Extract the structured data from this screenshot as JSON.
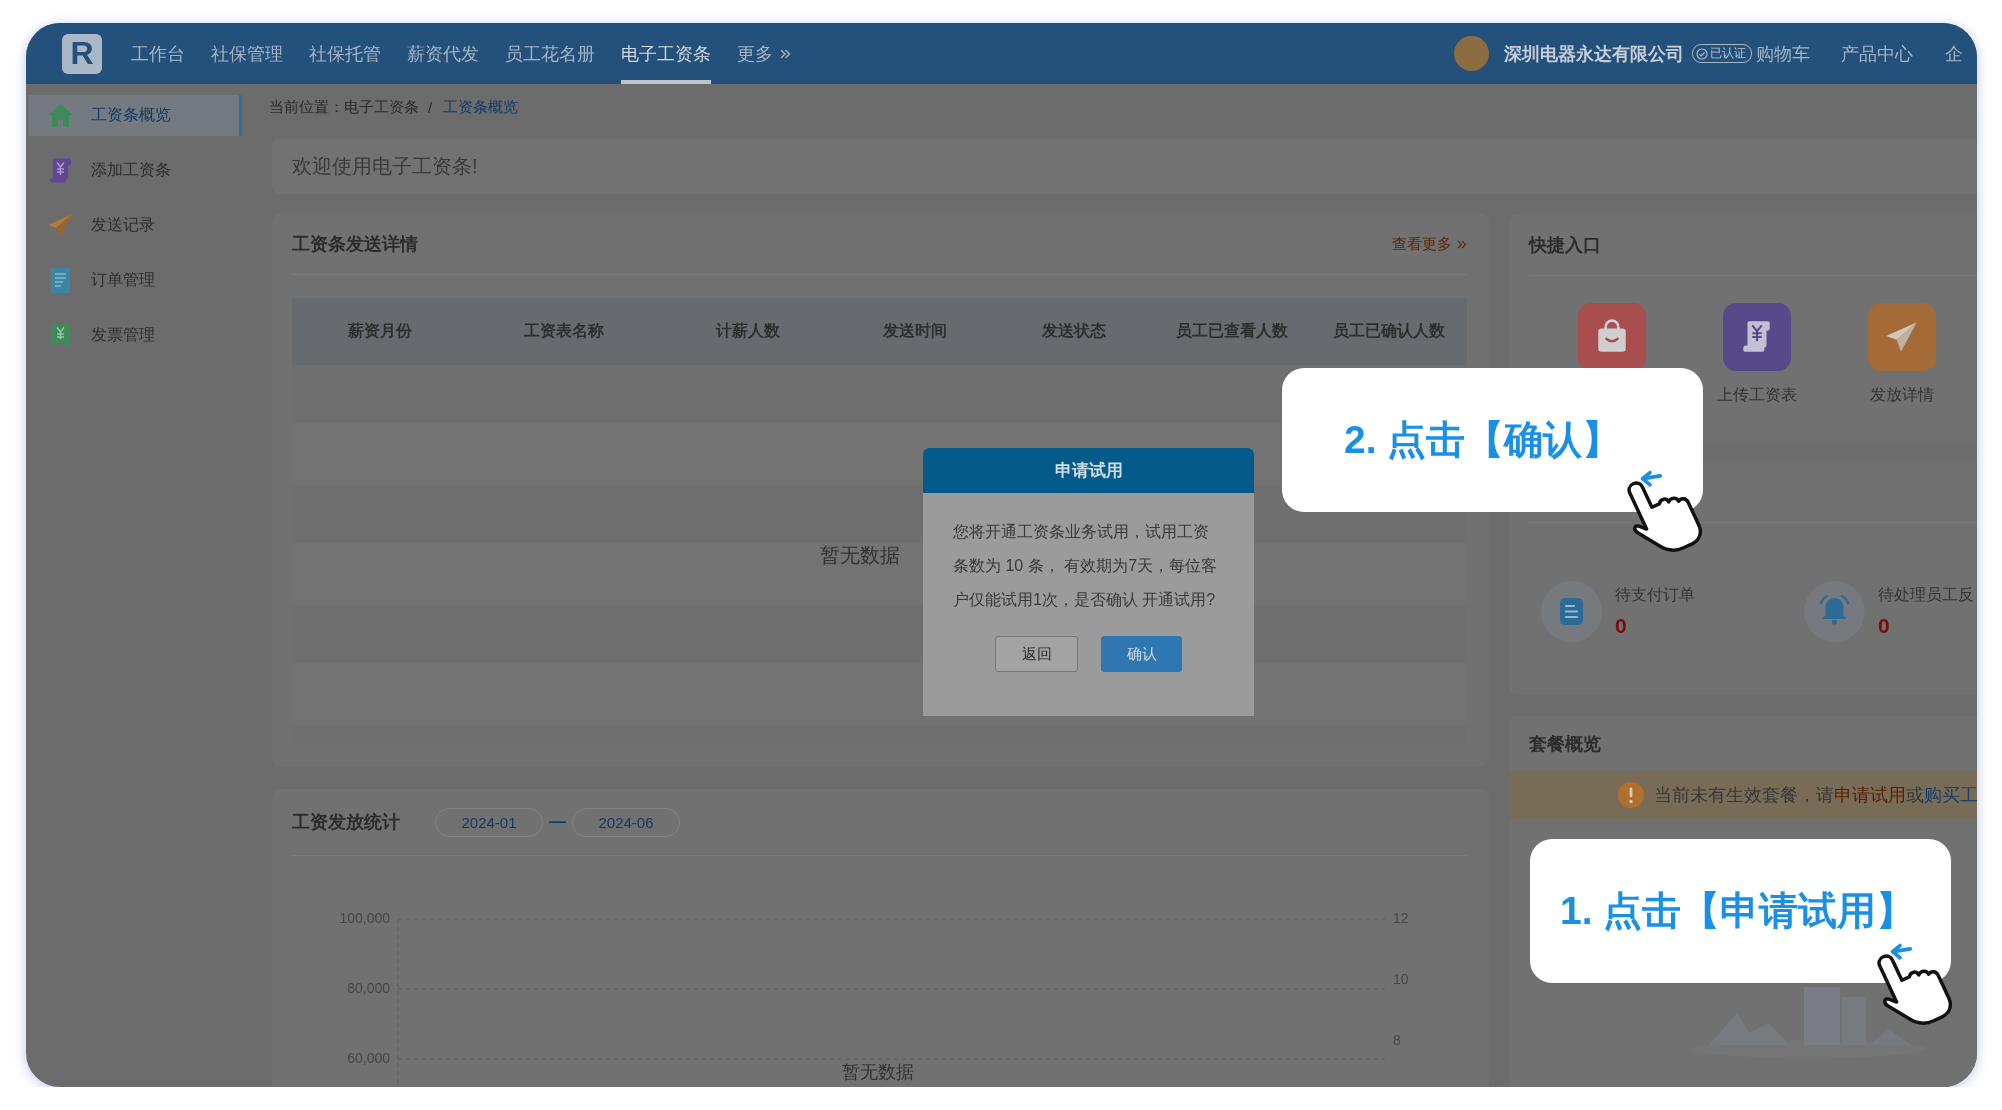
{
  "nav": {
    "logo": "R",
    "items": [
      {
        "label": "工作台",
        "selected": false,
        "more": false
      },
      {
        "label": "社保管理",
        "selected": false,
        "more": false
      },
      {
        "label": "社保托管",
        "selected": false,
        "more": false
      },
      {
        "label": "薪资代发",
        "selected": false,
        "more": false
      },
      {
        "label": "员工花名册",
        "selected": false,
        "more": false
      },
      {
        "label": "电子工资条",
        "selected": true,
        "more": false
      },
      {
        "label": "更多",
        "selected": false,
        "more": true
      }
    ],
    "company": "深圳电器永达有限公司",
    "verified_badge": "已认证",
    "links": [
      "购物车",
      "产品中心",
      "企"
    ]
  },
  "sidebar": {
    "items": [
      {
        "label": "工资条概览",
        "selected": true
      },
      {
        "label": "添加工资条",
        "selected": false
      },
      {
        "label": "发送记录",
        "selected": false
      },
      {
        "label": "订单管理",
        "selected": false
      },
      {
        "label": "发票管理",
        "selected": false
      }
    ]
  },
  "breadcrumb": {
    "prefix": "当前位置：",
    "separator": "/",
    "items": [
      {
        "label": "电子工资条",
        "current": false
      },
      {
        "label": "工资条概览",
        "current": true
      }
    ]
  },
  "welcome": "欢迎使用电子工资条!",
  "send_details": {
    "title": "工资条发送详情",
    "more_link": "查看更多",
    "columns": [
      "薪资月份",
      "工资表名称",
      "计薪人数",
      "发送时间",
      "发送状态",
      "员工已查看人数",
      "员工已确认人数"
    ],
    "empty_text": "暂无数据"
  },
  "payroll_stats": {
    "title": "工资发放统计",
    "date_from": "2024-01",
    "date_separator": "—",
    "date_to": "2024-06",
    "left_axis_ticks": [
      "100,000",
      "80,000",
      "60,000"
    ],
    "right_axis_ticks": [
      "12",
      "10",
      "8"
    ],
    "empty_text": "暂无数据"
  },
  "quick_entry": {
    "title": "快捷入口",
    "items": [
      {
        "color": "#a84e4e"
      },
      {
        "label": "上传工资表",
        "color": "#574a8a"
      },
      {
        "label": "发放详情",
        "color": "#a46a38"
      }
    ]
  },
  "todo": {
    "items": [
      {
        "label": "待支付订单",
        "count": "0"
      },
      {
        "label": "待处理员工反",
        "count": "0"
      }
    ]
  },
  "package": {
    "title": "套餐概览",
    "notice": {
      "text": "当前未有生效套餐，请",
      "trial_link": "申请试用",
      "joiner": "或",
      "buy_link": "购买工"
    }
  },
  "dialog": {
    "title": "申请试用",
    "message_lines": [
      "您将开通工资条业务试用，试用工资",
      "条数为 10 条， 有效期为7天，每位客",
      "户仅能试用1次，是否确认 开通试用?"
    ],
    "buttons": [
      {
        "label": "返回",
        "kind": "secondary"
      },
      {
        "label": "确认",
        "kind": "primary"
      }
    ]
  },
  "callouts": [
    {
      "text": "2. 点击【确认】"
    },
    {
      "text": "1. 点击【申请试用】"
    }
  ]
}
